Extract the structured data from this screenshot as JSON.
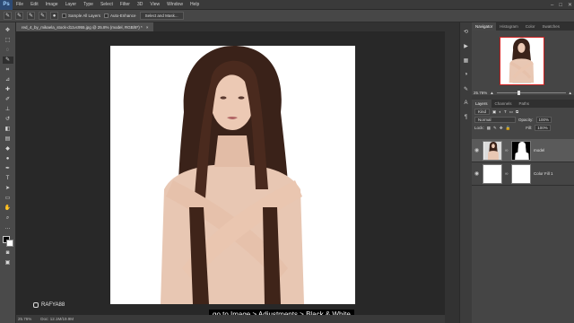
{
  "menubar": {
    "logo": "Ps",
    "items": [
      "File",
      "Edit",
      "Image",
      "Layer",
      "Type",
      "Select",
      "Filter",
      "3D",
      "View",
      "Window",
      "Help"
    ]
  },
  "options_bar": {
    "sample_all_layers": "Sample All Layers",
    "auto_enhance": "Auto-Enhance",
    "select_and_mask": "Select and Mask..."
  },
  "document": {
    "tab_title": "red_4_by_mikaela_stock-d11vc955.jpg @ 25.8% (model, RGB/8*) *",
    "close_glyph": "×"
  },
  "navigator": {
    "tabs": [
      "Navigator",
      "Histogram",
      "Color",
      "Swatches"
    ],
    "zoom": "25.76%"
  },
  "layers": {
    "tabs": [
      "Layers",
      "Channels",
      "Paths"
    ],
    "kind_label": "Kind",
    "blend_mode": "Normal",
    "opacity_label": "Opacity:",
    "opacity_value": "100%",
    "lock_label": "Lock:",
    "fill_label": "Fill:",
    "fill_value": "100%",
    "items": [
      {
        "name": "model"
      },
      {
        "name": "Color Fill 1"
      }
    ]
  },
  "status": {
    "zoom": "25.76%",
    "doc_info": "Doc: 12.1M/19.9M"
  },
  "watermark": "RAFYA88",
  "subtitle": "go to Image > Adjustments > Black & White",
  "colors": {
    "accent_red": "#d02020",
    "ps_blue": "#2d4a74"
  }
}
